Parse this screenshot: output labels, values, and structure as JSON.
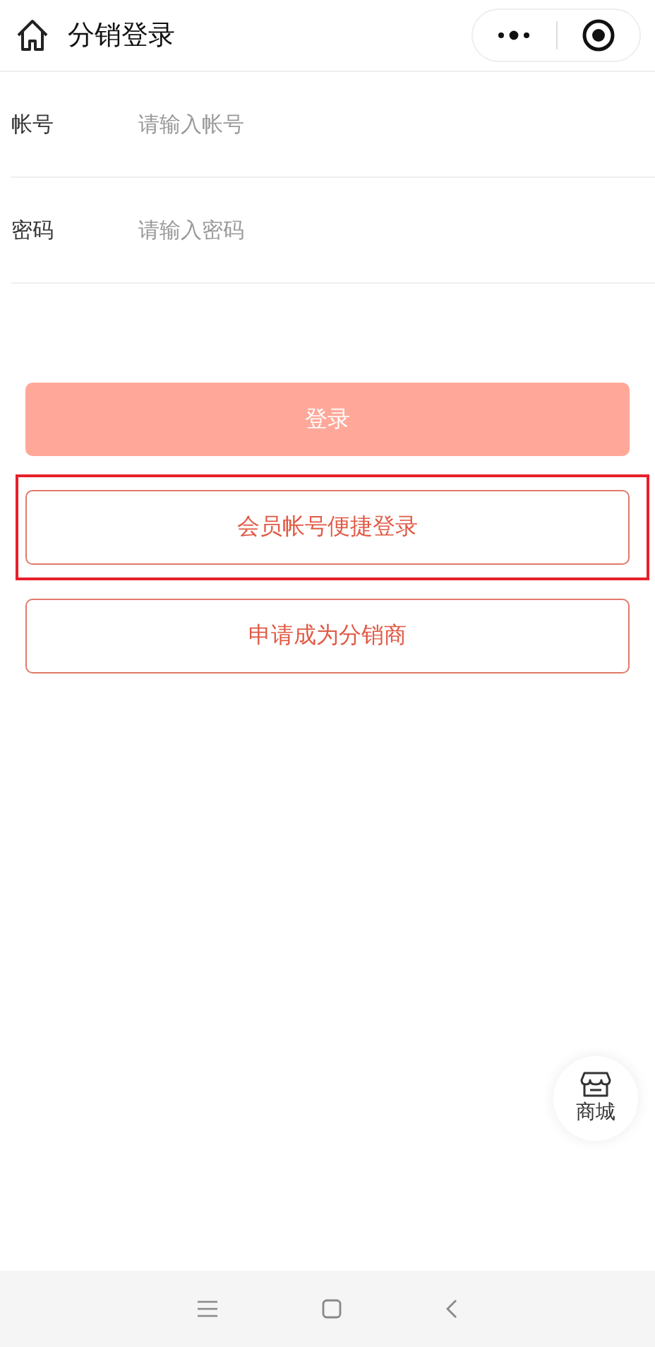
{
  "header": {
    "title": "分销登录"
  },
  "fields": [
    {
      "label": "帐号",
      "placeholder": "请输入帐号"
    },
    {
      "label": "密码",
      "placeholder": "请输入密码"
    }
  ],
  "buttons": [
    {
      "label": "登录",
      "kind": "primary",
      "highlighted": false
    },
    {
      "label": "会员帐号便捷登录",
      "kind": "outline",
      "highlighted": true
    },
    {
      "label": "申请成为分销商",
      "kind": "outline",
      "highlighted": false
    }
  ],
  "float_button": {
    "label": "商城"
  }
}
